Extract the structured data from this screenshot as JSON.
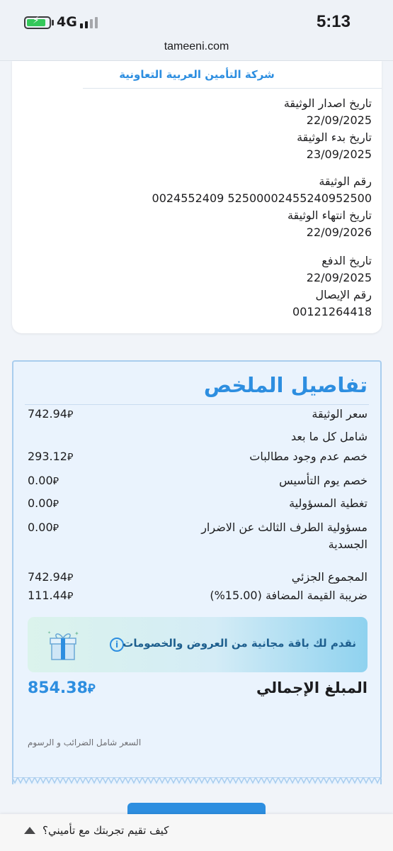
{
  "status": {
    "time": "5:13",
    "network": "4G",
    "icons": [
      "battery-charging-icon",
      "signal-icon"
    ]
  },
  "browser": {
    "url": "tameeni.com"
  },
  "policy": {
    "company": "شركة التأمين العربية التعاونية",
    "fields": [
      {
        "label": "تاريخ اصدار الوثيقة",
        "value": "22/09/2025"
      },
      {
        "label": "تاريخ بدء الوثيقة",
        "value": "23/09/2025"
      },
      {
        "label": "رقم الوثيقة",
        "value": "0024552409 5250000245524095250‌0"
      },
      {
        "label": "تاريخ انتهاء الوثيقة",
        "value": "22/09/2026"
      },
      {
        "label": "تاريخ الدفع",
        "value": "22/09/2025"
      },
      {
        "label": "رقم الإيصال",
        "value": "00121264418"
      }
    ]
  },
  "summary": {
    "title": "تفاصيل الملخص",
    "currency": "⃁",
    "rows": [
      {
        "label": "سعر الوثيقة",
        "value": "742.94"
      },
      {
        "label": "شامل كل ما بعد",
        "value": ""
      },
      {
        "label": "خصم عدم وجود مطالبات",
        "value": "293.12"
      },
      {
        "label": "خصم يوم التأسيس",
        "value": "0.00"
      },
      {
        "label": "تغطية المسؤولية",
        "value": "0.00"
      },
      {
        "label": "مسؤولية الطرف الثالث عن الاضرار الجسدية",
        "value": "0.00"
      },
      {
        "label": "المجموع الجزئي",
        "value": "742.94"
      },
      {
        "label": "ضريبة القيمة المضافة (15.00%)",
        "value": "111.44"
      }
    ],
    "offer": "نقدم لك باقة مجانية من العروض والخصومات",
    "total_label": "المبلغ الإجمالي",
    "total_value": "854.38",
    "tax_note": "السعر شامل الضرائب و الرسوم"
  },
  "feedback": {
    "text": "كيف تقيم تجربتك مع تأميني؟"
  },
  "colors": {
    "accent": "#2d8ee0",
    "summary_bg": "#eaf3fd",
    "summary_border": "#a9cdee"
  }
}
